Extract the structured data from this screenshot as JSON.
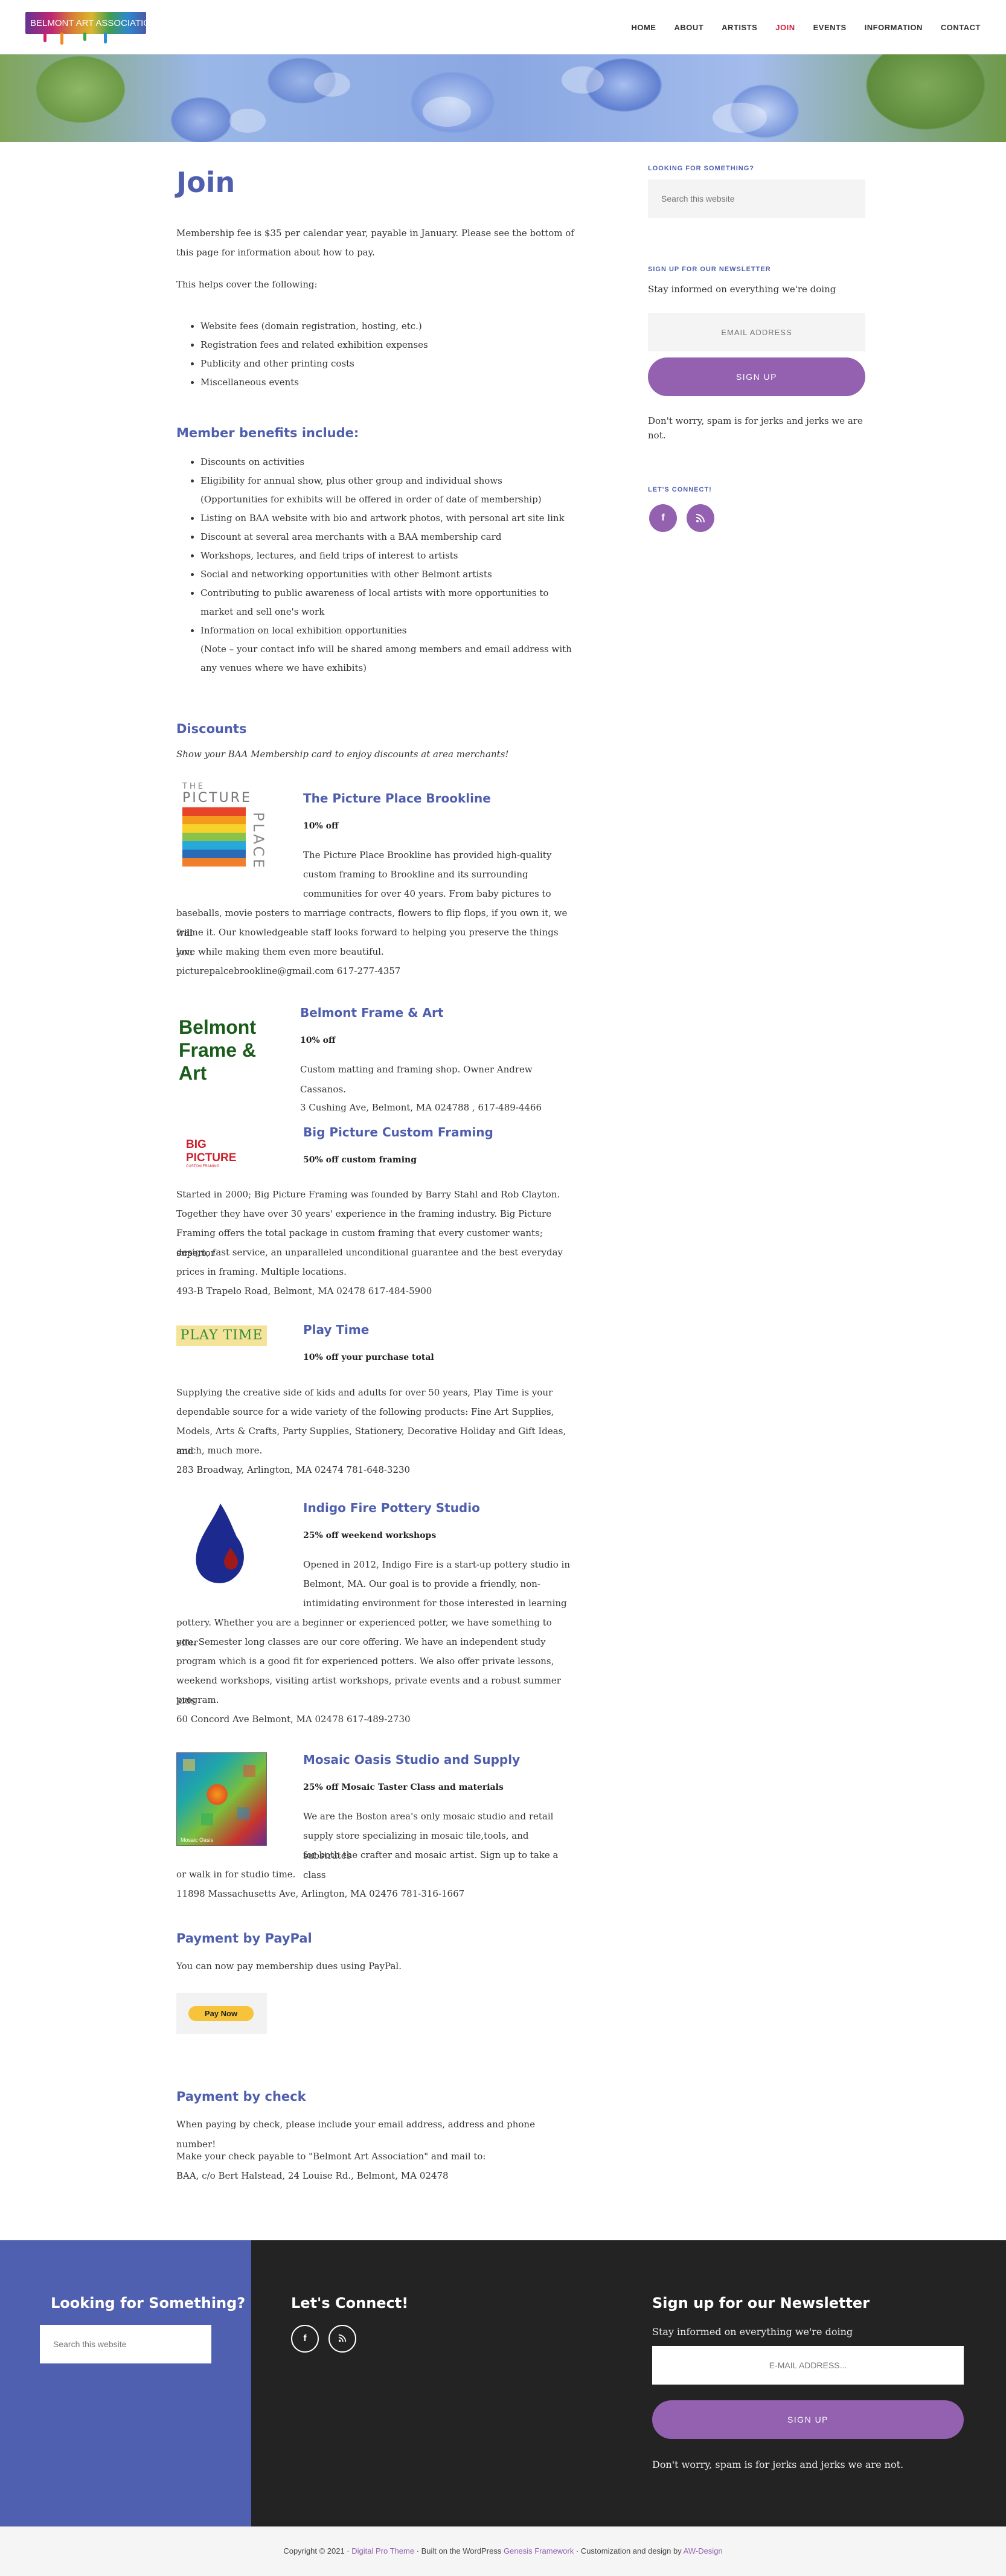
{
  "header": {
    "logo_text": "BELMONT ART ASSOCIATION",
    "nav": [
      "HOME",
      "ABOUT",
      "ARTISTS",
      "JOIN",
      "EVENTS",
      "INFORMATION",
      "CONTACT"
    ],
    "active_nav": "JOIN"
  },
  "main": {
    "title": "Join",
    "intro_1": "Membership fee is $35 per calendar year, payable in January. Please see the bottom of",
    "intro_2": "this page for information about how to pay.",
    "covers_intro": "This helps cover the following:",
    "covers": [
      "Website fees (domain registration, hosting, etc.)",
      "Registration fees and related exhibition expenses",
      "Publicity and other printing costs",
      "Miscellaneous events"
    ],
    "benefits_heading": "Member benefits include:",
    "benefits": [
      "Discounts on activities",
      "Eligibility for annual show, plus other group and individual shows",
      "(Opportunities for exhibits will be offered in order of date of membership)",
      "Listing on BAA website with bio and artwork photos, with personal art site link",
      "Discount at several area merchants with a BAA membership card",
      "Workshops, lectures, and field trips of interest to artists",
      "Social and networking opportunities with other Belmont artists",
      "Contributing to public awareness of local artists with more opportunities to",
      "market and sell one's work",
      "Information on local exhibition opportunities",
      "(Note – your contact info will be shared among members and email address with",
      "any venues where we have exhibits)"
    ],
    "discounts_heading": "Discounts",
    "discounts_intro": "Show your BAA Membership card to enjoy discounts at area merchants!",
    "merchants": [
      {
        "name": "The Picture Place Brookline",
        "deal": "10% off",
        "logo_text": [
          "THE",
          "PICTURE",
          "PLACE"
        ],
        "lines": [
          "The Picture Place Brookline has provided high-quality",
          "custom framing to Brookline and its surrounding",
          "communities for over 40 years. From baby pictures to",
          "baseballs, movie posters to marriage contracts, flowers to flip flops, if you own it, we will",
          "frame it. Our knowledgeable staff looks forward to helping you preserve the things you",
          "love while making them even more beautiful.",
          "picturepalcebrookline@gmail.com 617-277-4357"
        ]
      },
      {
        "name": "Belmont Frame & Art",
        "deal": "10% off",
        "logo_text": [
          "Belmont",
          "Frame &",
          "Art"
        ],
        "lines": [
          "Custom matting and framing shop. Owner Andrew Cassanos.",
          "3 Cushing Ave, Belmont, MA 024788 ,  617-489-4466"
        ]
      },
      {
        "name": "Big Picture Custom Framing",
        "deal": "50% off custom framing",
        "logo_text": [
          "BIG PICTURE",
          "CUSTOM FRAMING"
        ],
        "lines": [
          "Started in 2000; Big Picture Framing was founded by Barry Stahl and Rob Clayton.",
          "Together they have over 30 years' experience in the framing industry. Big Picture",
          "Framing offers the total package in custom framing that every customer wants; superior",
          "design, fast service, an unparalleled unconditional guarantee and the best everyday",
          "prices in framing. Multiple locations.",
          "493-B Trapelo Road, Belmont, MA 02478    617-484-5900"
        ]
      },
      {
        "name": "Play Time",
        "deal": "10% off your purchase total",
        "logo_text": [
          "PLAY TIME"
        ],
        "lines": [
          "Supplying the creative side of kids and adults for over 50 years, Play Time is your",
          "dependable source for a wide variety of the following products: Fine Art Supplies,",
          "Models, Arts & Crafts, Party Supplies, Stationery, Decorative Holiday and Gift Ideas, and",
          "much, much more.",
          "283 Broadway, Arlington, MA 02474  781-648-3230"
        ]
      },
      {
        "name": "Indigo Fire Pottery Studio",
        "deal": "25% off weekend workshops",
        "lines": [
          "Opened in 2012, Indigo Fire is a start-up pottery studio in",
          "Belmont, MA. Our goal is to provide a friendly, non-",
          "intimidating environment for those interested in learning",
          "pottery. Whether you are a beginner or experienced potter, we have something to offer",
          "you. Semester long classes are our core offering. We have an independent study",
          "program which is a good fit for experienced potters.  We also offer private lessons,",
          "weekend workshops, visiting artist workshops, private events and a robust summer kids",
          "program.",
          "60 Concord Ave Belmont, MA 02478  617-489-2730"
        ]
      },
      {
        "name": "Mosaic Oasis Studio and Supply",
        "deal": "25% off Mosaic Taster Class and materials",
        "logo_text": [
          "Mosaic Oasis"
        ],
        "lines": [
          "We are the Boston area's only mosaic studio and retail",
          "supply store specializing in mosaic tile,tools, and substrates",
          "for both the crafter and mosaic artist. Sign up to take a class",
          "or walk in for studio time.",
          "11898 Massachusetts Ave, Arlington, MA 02476  781-316-1667"
        ]
      }
    ],
    "paypal_heading": "Payment by PayPal",
    "paypal_text": "You can now pay membership dues using PayPal.",
    "paypal_button": "Pay Now",
    "check_heading": "Payment by check",
    "check_1": "When paying by check, please include your email address, address and phone number!",
    "check_2": "Make your check payable to \"Belmont Art Association\" and mail to:",
    "check_3": "BAA, c/o Bert Halstead, 24 Louise Rd., Belmont, MA 02478"
  },
  "sidebar": {
    "search_heading": "LOOKING FOR SOMETHING?",
    "search_placeholder": "Search this website",
    "newsletter_heading": "SIGN UP FOR OUR NEWSLETTER",
    "newsletter_text": "Stay informed on everything we're doing",
    "email_placeholder": "EMAIL ADDRESS",
    "signup_label": "SIGN UP",
    "spam_1": "Don't worry, spam is for jerks and jerks we are",
    "spam_2": "not.",
    "connect_heading": "LET'S CONNECT!",
    "social": [
      "f",
      "rss"
    ]
  },
  "footer": {
    "search_heading": "Looking for Something?",
    "search_placeholder": "Search this website",
    "connect_heading": "Let's Connect!",
    "newsletter_heading": "Sign up for our Newsletter",
    "newsletter_text": "Stay informed on everything we're doing",
    "email_placeholder": "E-MAIL ADDRESS...",
    "signup_label": "SIGN UP",
    "spam": "Don't worry, spam is for jerks and jerks we are not.",
    "copyright_pre": "Copyright © 2021 · ",
    "theme": "Digital Pro Theme",
    "built": " · Built on the WordPress ",
    "framework": "Genesis Framework",
    "custom": " · Customization and design by ",
    "designer": "AW-Design"
  },
  "colors": {
    "accent_blue": "#4f5fae",
    "accent_purple": "#9361b0",
    "nav_active": "#d21e3c",
    "footer_dark": "#232323",
    "footer_blue": "#5060b0"
  }
}
